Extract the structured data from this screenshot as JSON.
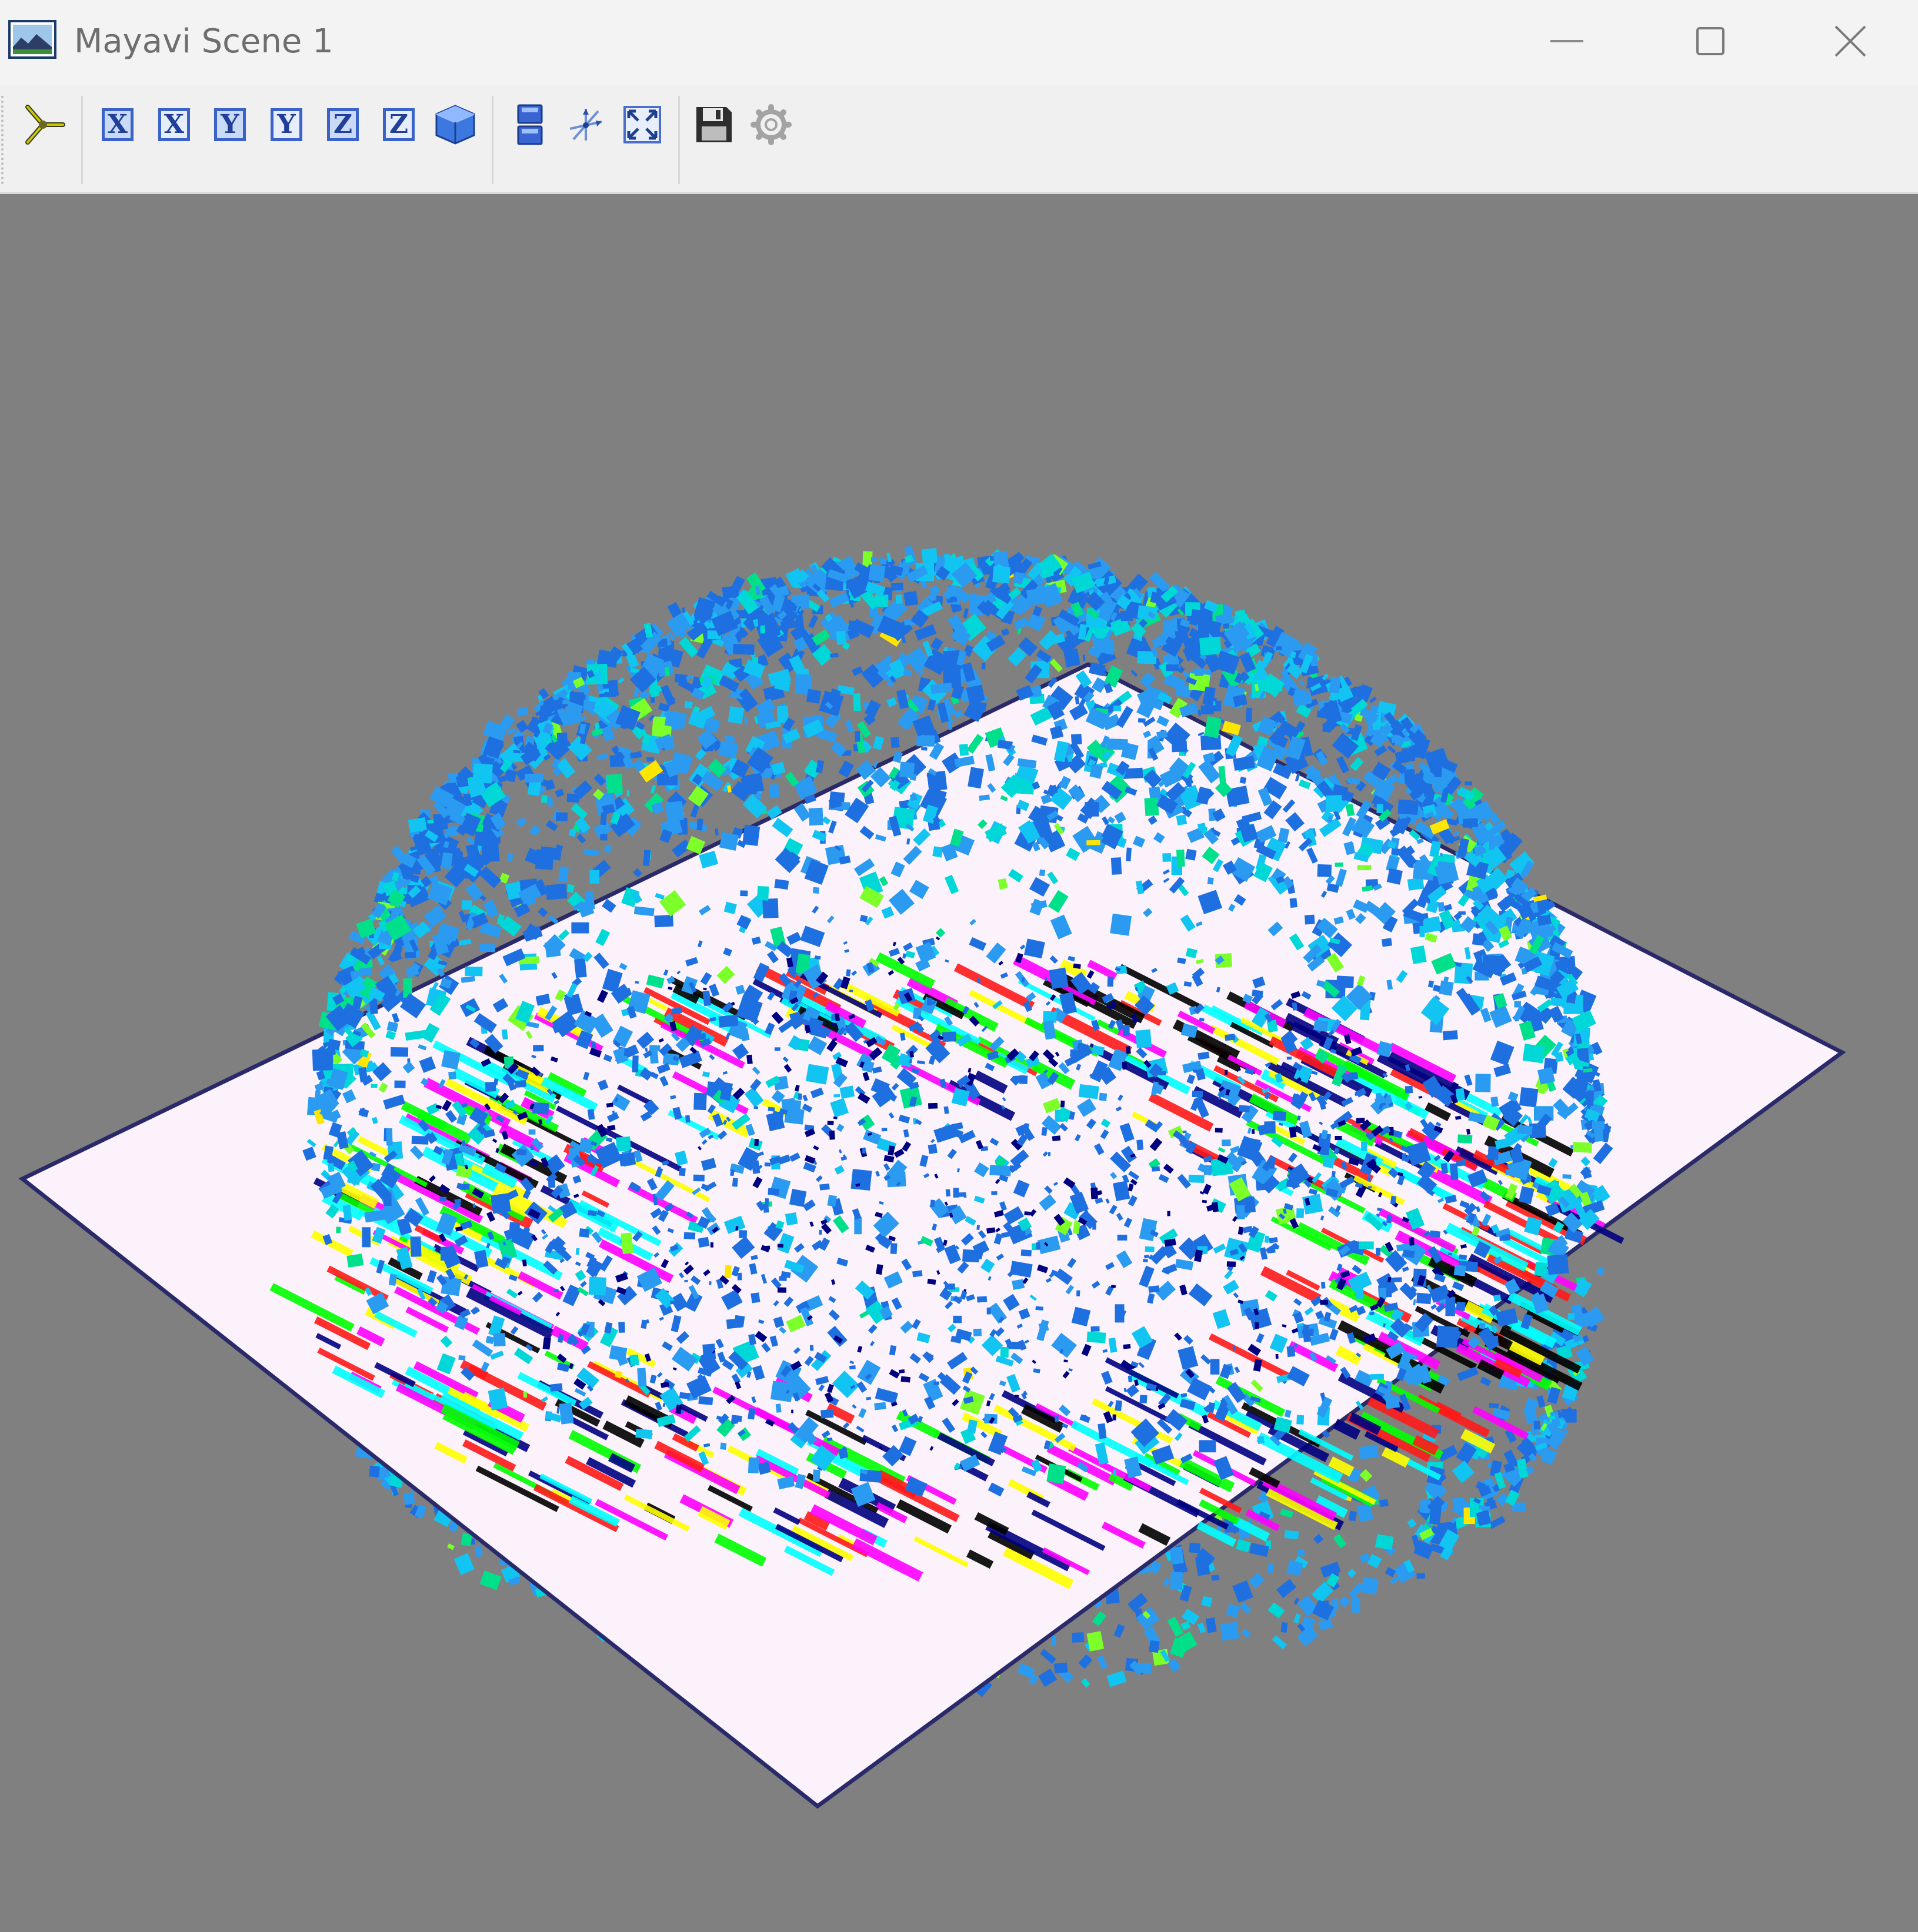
{
  "window": {
    "title": "Mayavi Scene 1",
    "icon": "mayavi-scene-icon",
    "controls": {
      "minimize": "minimize-icon",
      "maximize": "maximize-icon",
      "close": "close-icon"
    }
  },
  "toolbar": {
    "tools": [
      {
        "id": "pipeline",
        "icon": "mayavi-pipeline-icon"
      },
      {
        "id": "view-plus-x",
        "label": "X",
        "icon": "axis-x-icon"
      },
      {
        "id": "view-minus-x",
        "label": "X",
        "icon": "axis-x-icon"
      },
      {
        "id": "view-plus-y",
        "label": "Y",
        "icon": "axis-y-icon"
      },
      {
        "id": "view-minus-y",
        "label": "Y",
        "icon": "axis-y-icon"
      },
      {
        "id": "view-plus-z",
        "label": "Z",
        "icon": "axis-z-icon"
      },
      {
        "id": "view-minus-z",
        "label": "Z",
        "icon": "axis-z-icon"
      },
      {
        "id": "isometric",
        "icon": "cube-icon"
      },
      {
        "id": "parallel-projection",
        "icon": "projection-icon"
      },
      {
        "id": "axes-indicator",
        "icon": "axes-icon"
      },
      {
        "id": "full-screen",
        "icon": "fullscreen-icon"
      },
      {
        "id": "save",
        "icon": "save-icon"
      },
      {
        "id": "configure",
        "icon": "gear-icon"
      }
    ]
  },
  "scene": {
    "background": "#808080",
    "plane_color": "#fbf2fb",
    "glyph_colors": [
      "#1e6fe0",
      "#2a9bf0",
      "#12c4f2",
      "#00d8d8",
      "#00e08a",
      "#7dff2a",
      "#ffe600"
    ],
    "band_colors": [
      "#000080",
      "#ff1a1a",
      "#00ff00",
      "#ff00ff",
      "#ffff00",
      "#00ffff",
      "#000000"
    ]
  }
}
